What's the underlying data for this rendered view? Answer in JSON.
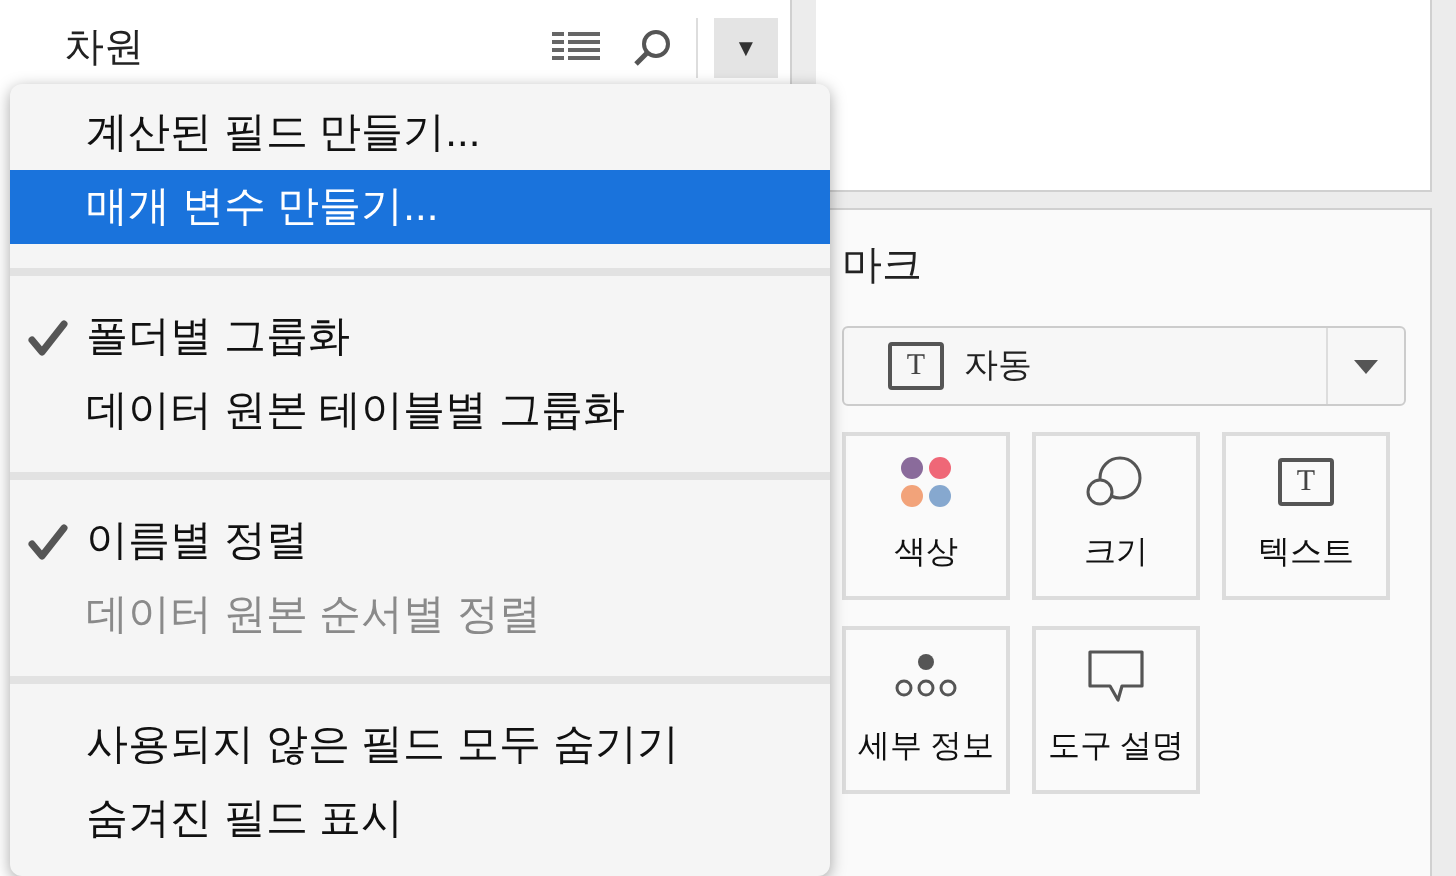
{
  "dimensions_panel": {
    "title": "차원",
    "menu_button": "▼"
  },
  "context_menu": {
    "sections": [
      {
        "items": [
          {
            "label": "계산된 필드 만들기...",
            "selected": false,
            "checked": false,
            "disabled": false
          },
          {
            "label": "매개 변수 만들기...",
            "selected": true,
            "checked": false,
            "disabled": false
          }
        ]
      },
      {
        "items": [
          {
            "label": "폴더별 그룹화",
            "selected": false,
            "checked": true,
            "disabled": false
          },
          {
            "label": "데이터 원본 테이블별 그룹화",
            "selected": false,
            "checked": false,
            "disabled": false
          }
        ]
      },
      {
        "items": [
          {
            "label": "이름별 정렬",
            "selected": false,
            "checked": true,
            "disabled": false
          },
          {
            "label": "데이터 원본 순서별 정렬",
            "selected": false,
            "checked": false,
            "disabled": true
          }
        ]
      },
      {
        "items": [
          {
            "label": "사용되지 않은 필드 모두 숨기기",
            "selected": false,
            "checked": false,
            "disabled": false
          },
          {
            "label": "숨겨진 필드 표시",
            "selected": false,
            "checked": false,
            "disabled": false
          }
        ]
      }
    ]
  },
  "marks_panel": {
    "title": "마크",
    "mark_type": {
      "label": "자동",
      "icon_letter": "T"
    },
    "cards": [
      {
        "kind": "color",
        "label": "색상"
      },
      {
        "kind": "size",
        "label": "크기"
      },
      {
        "kind": "text",
        "label": "텍스트",
        "icon_letter": "T"
      },
      {
        "kind": "detail",
        "label": "세부 정보"
      },
      {
        "kind": "tooltip",
        "label": "도구 설명"
      }
    ]
  }
}
